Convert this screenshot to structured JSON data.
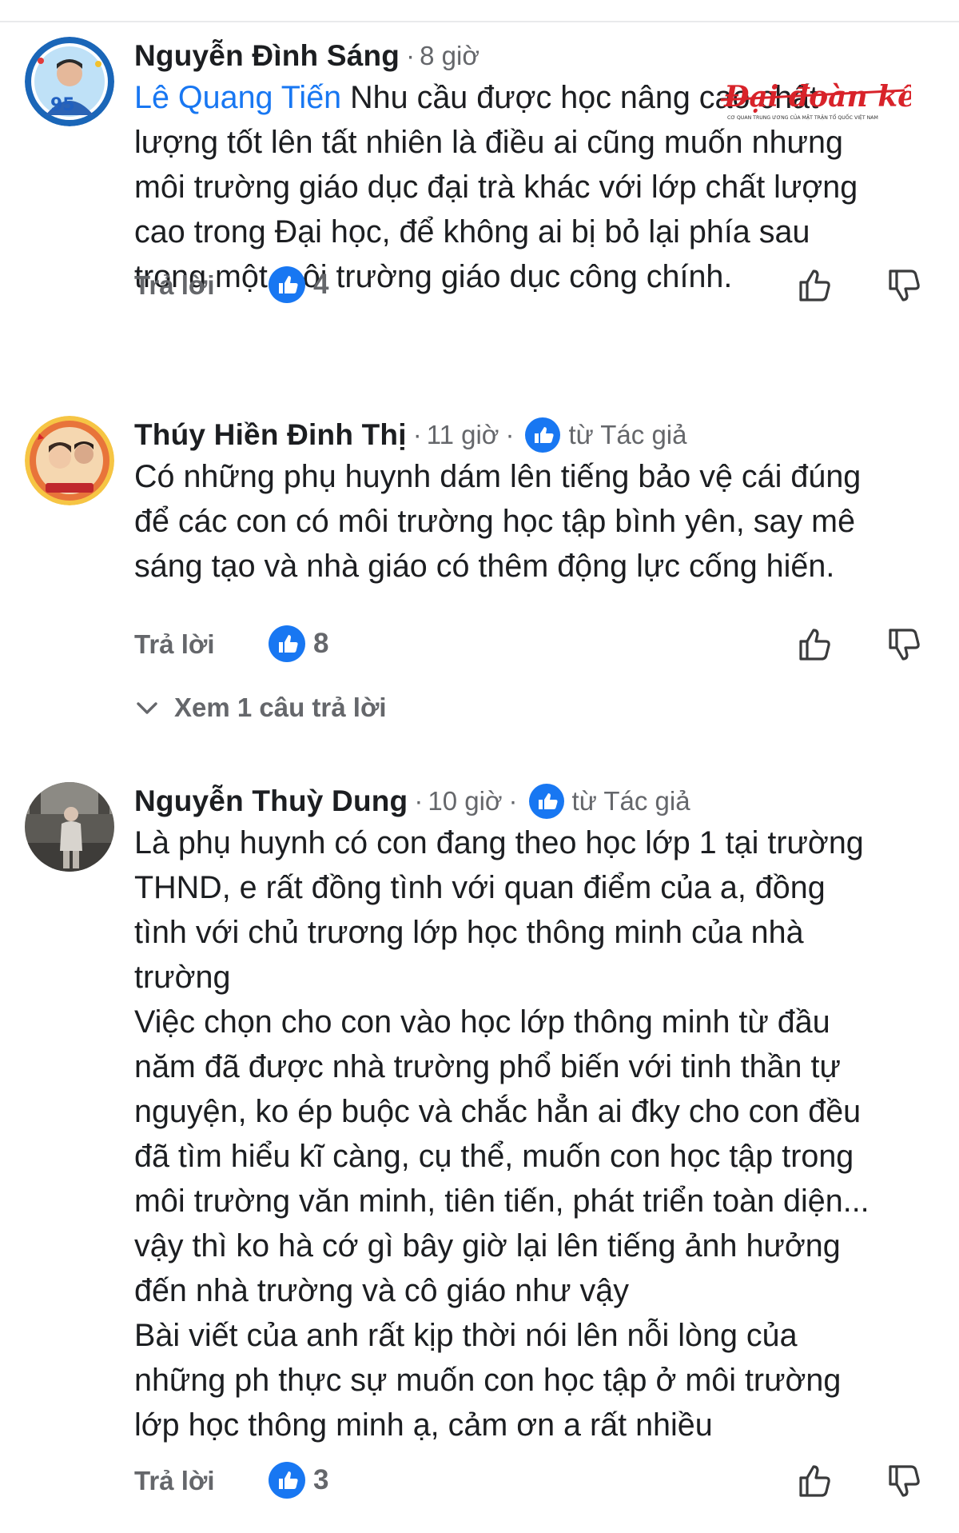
{
  "comments": [
    {
      "author": "Nguyễn Đình Sáng",
      "time": "8 giờ",
      "mention": "Lê Quang Tiến",
      "text": "Nhu cầu được học nâng cao chất\nlượng tốt lên tất nhiên là điều ai cũng muốn nhưng\nmôi trường giáo dục đại trà khác với lớp chất lượng\ncao trong Đại học, để không ai bị bỏ lại phía sau\ntrong một môi trường giáo dục công chính.",
      "reply_label": "Trả lời",
      "likes": "4"
    },
    {
      "author": "Thúy Hiền Đinh Thị",
      "time": "11 giờ",
      "badge": "từ Tác giả",
      "text": "Có những phụ huynh dám lên tiếng bảo vệ cái đúng\nđể các con có môi trường học tập bình yên, say mê\nsáng tạo và nhà giáo có thêm động lực cống hiến.",
      "reply_label": "Trả lời",
      "likes": "8",
      "view_replies": "Xem 1 câu trả lời"
    },
    {
      "author": "Nguyễn Thuỳ Dung",
      "time": "10 giờ",
      "badge": "từ Tác giả",
      "text": "Là phụ huynh có con đang theo học lớp 1 tại trường\nTHND, e rất đồng tình với quan điểm của a, đồng\ntình với chủ trương lớp học thông minh của nhà\ntrường\nViệc chọn cho con vào học lớp thông minh từ đầu\nnăm đã được nhà trường phổ biến với tinh thần tự\nnguyện, ko ép buộc và chắc hẳn ai đky cho con đều\nđã tìm hiểu kĩ càng, cụ thể, muốn con học tập trong\nmôi trường văn minh, tiên tiến, phát triển toàn diện...\nvậy thì ko hà cớ gì bây giờ lại lên tiếng ảnh hưởng\nđến nhà trường và cô giáo như vậy\nBài viết của anh rất kịp thời nói lên nỗi lòng của\nnhững ph thực sự muốn con học tập ở môi trường\nlớp học thông minh ạ, cảm ơn a rất nhiều",
      "reply_label": "Trả lời",
      "likes": "3"
    }
  ],
  "watermark": {
    "logo": "Đại đoàn kết",
    "tagline": "CƠ QUAN TRUNG ƯƠNG CỦA MẶT TRẬN TỔ QUỐC VIỆT NAM"
  },
  "colors": {
    "like_blue": "#1877f2",
    "secondary_text": "#65676b",
    "mention": "#1877f2",
    "watermark_red": "#d8232a"
  }
}
